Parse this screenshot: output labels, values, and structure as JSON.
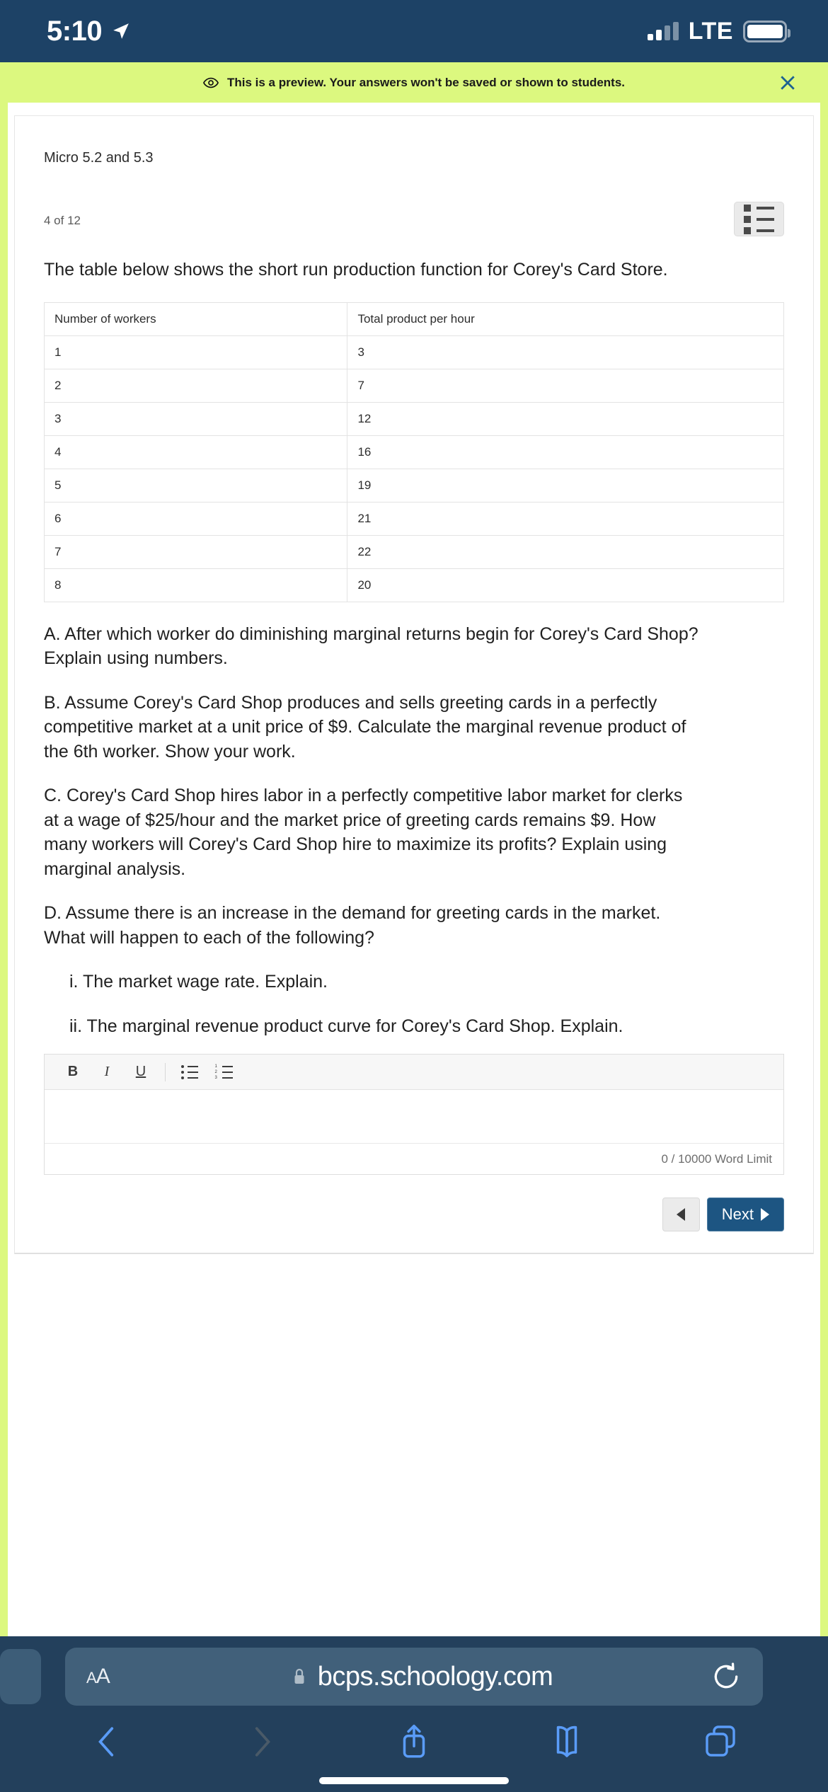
{
  "status_bar": {
    "time": "5:10",
    "location_icon": "location-arrow-icon",
    "network": "LTE",
    "signal_icon": "cellular-signal-icon",
    "battery_icon": "battery-icon"
  },
  "preview_banner": {
    "icon": "eye-icon",
    "message": "This is a preview. Your answers won't be saved or shown to students.",
    "close_icon": "close-icon",
    "background": "#dcf87f"
  },
  "assessment": {
    "title": "Micro 5.2 and 5.3",
    "question_counter": "4 of 12",
    "list_toggle_icon": "list-view-icon",
    "prompt": "The table below shows the short run production function for Corey's Card Store.",
    "table": {
      "headers": [
        "Number of workers",
        "Total product per hour"
      ],
      "rows": [
        [
          "1",
          "3"
        ],
        [
          "2",
          "7"
        ],
        [
          "3",
          "12"
        ],
        [
          "4",
          "16"
        ],
        [
          "5",
          "19"
        ],
        [
          "6",
          "21"
        ],
        [
          "7",
          "22"
        ],
        [
          "8",
          "20"
        ]
      ]
    },
    "parts": {
      "a": "A.  After which worker do diminishing marginal returns begin for Corey's Card Shop?  Explain using numbers.",
      "b": "B.  Assume Corey's Card Shop produces and sells greeting cards in a perfectly competitive market at a unit price of $9.  Calculate the marginal revenue product of the 6th worker.  Show your work.",
      "c": "C.  Corey's Card Shop hires labor in a perfectly competitive labor market for clerks at a wage of $25/hour and the market price of greeting cards remains $9.  How many workers will Corey's Card Shop hire to maximize its profits?  Explain using marginal analysis.",
      "d": "D.  Assume there is an increase in the demand for greeting cards in the market.  What will happen to each of the following?",
      "d_i": "i.  The market wage rate.  Explain.",
      "d_ii": "ii.  The marginal revenue product curve for Corey's Card Shop.  Explain."
    },
    "editor": {
      "bold_label": "B",
      "italic_label": "I",
      "underline_label": "U",
      "bullet_list_icon": "bullet-list-icon",
      "numbered_list_icon": "numbered-list-icon",
      "answer_value": "",
      "word_limit": "0 / 10000 Word Limit"
    },
    "navigation": {
      "prev_icon": "triangle-left-icon",
      "next_label": "Next",
      "next_icon": "triangle-right-icon",
      "next_color": "#1d5582"
    }
  },
  "browser": {
    "text_size_label": "AA",
    "lock_icon": "lock-icon",
    "url": "bcps.schoology.com",
    "reload_icon": "reload-icon",
    "back_icon": "chevron-left-icon",
    "forward_icon": "chevron-right-icon",
    "share_icon": "share-icon",
    "bookmarks_icon": "book-icon",
    "tabs_icon": "tabs-icon",
    "home_indicator": "home-indicator"
  }
}
